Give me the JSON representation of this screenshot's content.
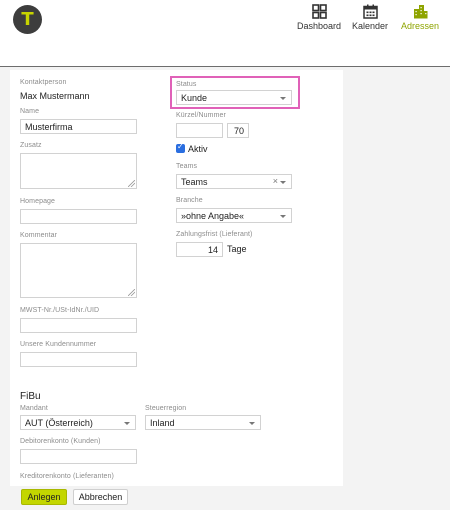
{
  "header": {
    "logo_letter": "T",
    "nav": [
      {
        "label": "Dashboard",
        "icon": "dashboard-icon"
      },
      {
        "label": "Kalender",
        "icon": "calendar-icon"
      },
      {
        "label": "Adressen",
        "icon": "buildings-icon",
        "active": true
      }
    ],
    "accent_color": "#c3d600"
  },
  "form": {
    "kontaktperson": {
      "label": "Kontaktperson",
      "value": "Max Mustermann"
    },
    "name": {
      "label": "Name",
      "value": "Musterfirma"
    },
    "zusatz": {
      "label": "Zusatz",
      "value": ""
    },
    "homepage": {
      "label": "Homepage",
      "value": ""
    },
    "kommentar": {
      "label": "Kommentar",
      "value": ""
    },
    "mwst": {
      "label": "MWST-Nr./USt-IdNr./UID",
      "value": ""
    },
    "kundennummer": {
      "label": "Unsere Kundennummer",
      "value": ""
    },
    "status": {
      "label": "Status",
      "value": "Kunde"
    },
    "kuerzel": {
      "label": "Kürzel/Nummer",
      "value": "",
      "number": "70"
    },
    "aktiv": {
      "label": "Aktiv",
      "checked": true
    },
    "teams": {
      "label": "Teams",
      "value": "Teams",
      "clear": "×"
    },
    "branche": {
      "label": "Branche",
      "value": "»ohne Angabe«"
    },
    "zahlungsfrist": {
      "label": "Zahlungsfrist (Lieferant)",
      "value": "14",
      "unit": "Tage"
    },
    "fibu": {
      "title": "FiBu",
      "mandant": {
        "label": "Mandant",
        "value": "AUT (Österreich)"
      },
      "steuerregion": {
        "label": "Steuerregion",
        "value": "Inland"
      },
      "debitorenkonto": {
        "label": "Debitorenkonto (Kunden)",
        "value": ""
      },
      "kreditorenkonto": {
        "label": "Kreditorenkonto (Lieferanten)",
        "value": ""
      }
    }
  },
  "actions": {
    "save_label": "Anlegen",
    "cancel_label": "Abbrechen"
  }
}
